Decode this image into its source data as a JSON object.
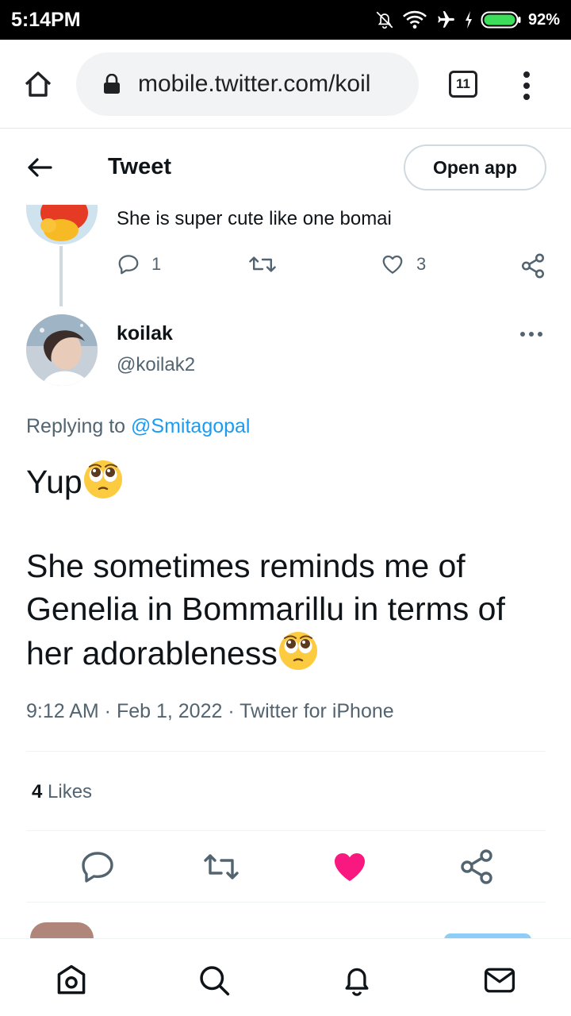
{
  "status_bar": {
    "time": "5:14PM",
    "battery": "92%"
  },
  "browser": {
    "url": "mobile.twitter.com/koil",
    "tab_count": "11"
  },
  "header": {
    "title": "Tweet",
    "open_app": "Open app"
  },
  "prev_tweet": {
    "text": "She is super cute like one bomai",
    "replies": "1",
    "likes": "3"
  },
  "tweet": {
    "name": "koilak",
    "handle": "@koilak2",
    "replying_prefix": "Replying to ",
    "replying_to": "@Smitagopal",
    "line1": "Yup",
    "line2": "She sometimes reminds me of Genelia in Bommarillu in terms of her adorableness",
    "meta": "9:12 AM · Feb 1, 2022 · Twitter for iPhone",
    "likes_count": "4",
    "likes_label": " Likes"
  },
  "icons": {
    "status": [
      "bell-off-icon",
      "wifi-icon",
      "airplane-icon",
      "charging-icon",
      "battery-icon"
    ],
    "browser": [
      "home-icon",
      "lock-icon",
      "tabs-icon",
      "overflow-menu-icon"
    ],
    "actions": [
      "reply-icon",
      "retweet-icon",
      "like-icon",
      "share-icon"
    ],
    "nav": [
      "home-icon",
      "search-icon",
      "notifications-icon",
      "messages-icon"
    ]
  },
  "colors": {
    "accent": "#1d9bf0",
    "like": "#f91880",
    "text": "#0f1419",
    "secondary": "#536471"
  }
}
